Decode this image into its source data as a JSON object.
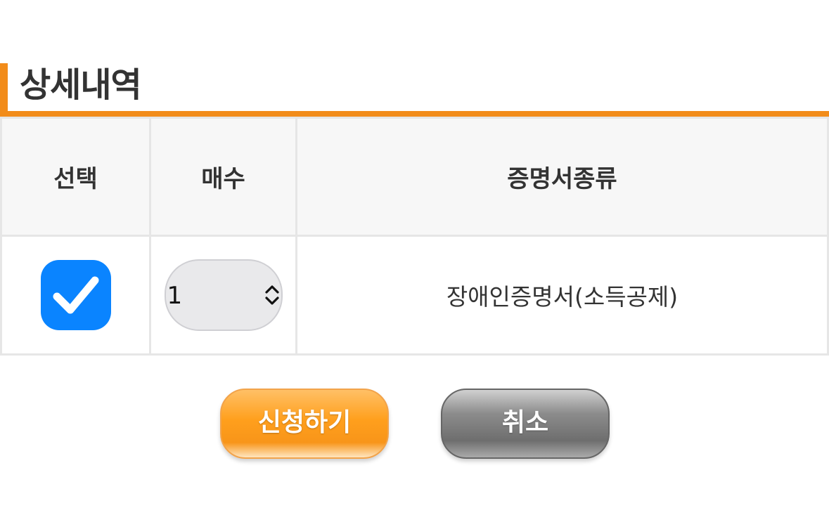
{
  "section": {
    "title": "상세내역"
  },
  "colors": {
    "accent": "#f28c1a",
    "checkbox": "#0a84ff",
    "cancel": "#777777"
  },
  "table": {
    "headers": {
      "select": "선택",
      "count": "매수",
      "doc_type": "증명서종류"
    },
    "rows": [
      {
        "selected": true,
        "count": "1",
        "doc_type": "장애인증명서(소득공제)"
      }
    ]
  },
  "buttons": {
    "apply_label": "신청하기",
    "cancel_label": "취소"
  },
  "icons": {
    "checkbox": "checkmark-icon",
    "stepper": "chevron-updown-icon"
  }
}
